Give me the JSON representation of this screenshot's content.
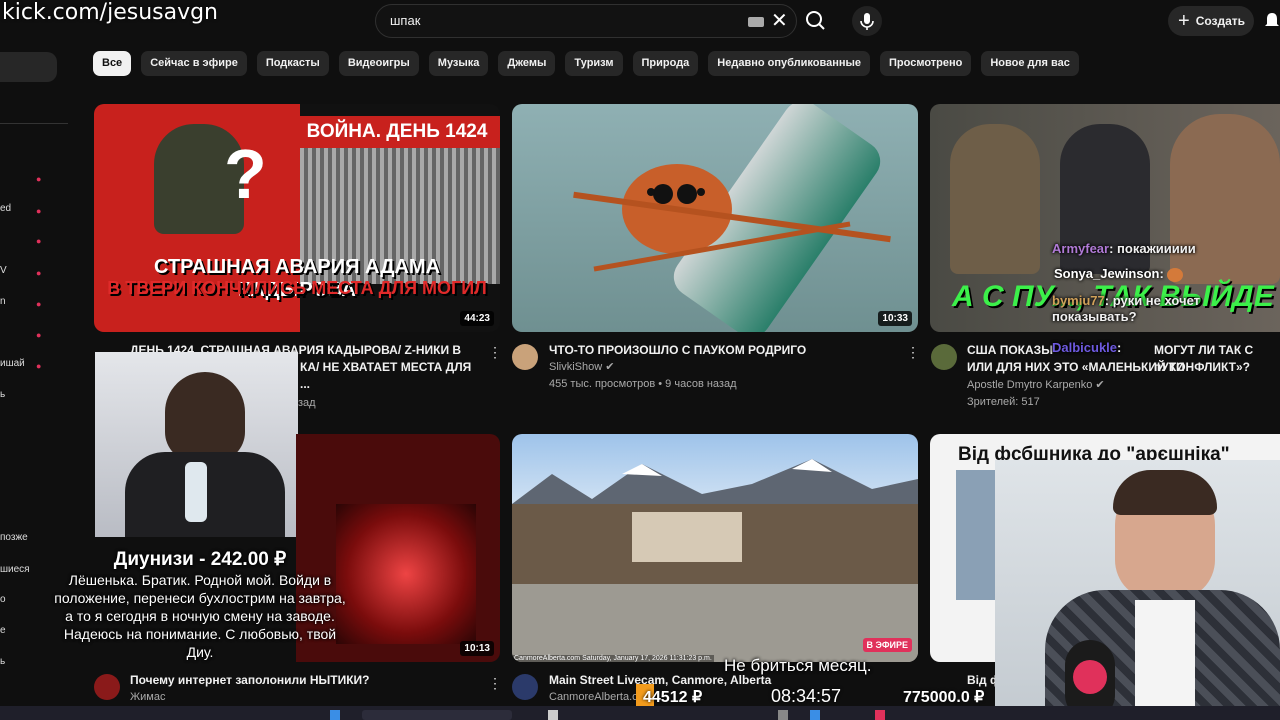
{
  "overlay": {
    "watermark": "kick.com/jesusavgn",
    "donation_header": "Диунизи - 242.00 ₽",
    "donation_message": "Лёшенька. Братик. Родной мой. Войди в положение, перенеси бухлострим на завтра, а то я сегодня в ночную смену на заводе. Надеюсь на понимание. С любовью, твой Диу.",
    "subtitle": "Не бриться месяц.",
    "stat_left": "44512 ₽",
    "clock": "08:34:57",
    "stat_right": "775000.0 ₽",
    "chat": [
      {
        "user": "Armyfear",
        "text": ": покажиииии",
        "color": "#b07ad6"
      },
      {
        "user": "Sonya_Jewinson",
        "text": ":",
        "color": "#ffffff"
      },
      {
        "user": "bymiu77",
        "text": ": руки не хочет показывать?",
        "color": "#d0a15a"
      },
      {
        "user": "Dalbicukle",
        "text": ":",
        "color": "#6e5ae0"
      }
    ]
  },
  "header": {
    "search_value": "шпак",
    "create_label": "Создать",
    "icons": [
      "keyboard-icon",
      "clear-icon",
      "search-icon",
      "mic-icon",
      "plus-icon",
      "bell-icon"
    ]
  },
  "sidebar": {
    "items": [
      "ed",
      "V",
      "n",
      "ишай",
      "ь",
      "позже",
      "шиеся",
      "о",
      "е",
      "ь"
    ]
  },
  "chips": [
    "Все",
    "Сейчас в эфире",
    "Подкасты",
    "Видеоигры",
    "Музыка",
    "Джемы",
    "Туризм",
    "Природа",
    "Недавно опубликованные",
    "Просмотрено",
    "Новое для вас"
  ],
  "videos": [
    {
      "thumb_top": "ВОЙНА. ДЕНЬ 1424",
      "thumb_caption_1": "СТРАШНАЯ АВАРИЯ АДАМА КАДЫРОВА",
      "thumb_caption_2": "В ТВЕРИ КОНЧИЛИСЬ МЕСТА ДЛЯ МОГИЛ",
      "duration": "44:23",
      "title_1": "ДЕНЬ 1424. СТРАШНАЯ АВАРИЯ КАДЫРОВА/ Z-НИКИ В",
      "title_2": "КА/ НЕ ХВАТАЕТ МЕСТА ДЛЯ ...",
      "meta": "зад"
    },
    {
      "duration": "10:33",
      "title": "ЧТО-ТО ПРОИЗОШЛО С ПАУКОМ РОДРИГО",
      "channel": "SlivkiShow",
      "meta": "455 тыс. просмотров • 9 часов назад"
    },
    {
      "thumb_caption": "А С ПУ..., ТАК ВЫЙДЕ",
      "title_1": "США ПОКАЗЫ",
      "title_2": "ИЛИ ДЛЯ НИХ ЭТО «МАЛЕНЬКИЙ КОНФЛИКТ»?",
      "title_tail": "МОГУТ ЛИ ТАК С пУТИ",
      "channel": "Apostle Dmytro Karpenko",
      "meta": "Зрителей: 517"
    },
    {
      "duration": "10:13",
      "title": "Почему интернет заполонили НЫТИКИ?",
      "channel": "Жимас"
    },
    {
      "live_badge": "В ЭФИРЕ",
      "cam_stamp": "CanmoreAlberta.com  Saturday, January 17, 2026  11:31:23 p.m.",
      "title": "Main Street Livecam, Canmore, Alberta",
      "channel": "CanmoreAlberta.com"
    },
    {
      "thumb_caption": "Від фсбшника до \"арєшніка\"",
      "title": "Від ф"
    }
  ]
}
